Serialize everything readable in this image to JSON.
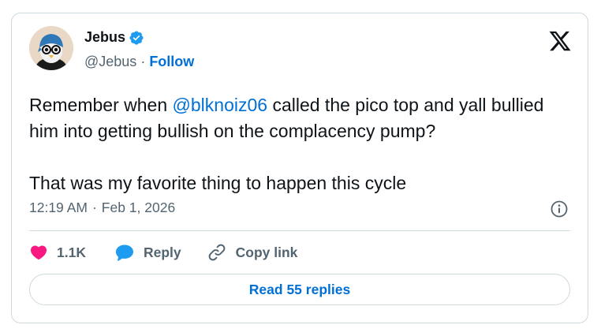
{
  "author": {
    "display_name": "Jebus",
    "handle": "@Jebus",
    "separator": "·",
    "follow_label": "Follow",
    "verified_color": "#1d9bf0",
    "avatar_icon": "penguin-avatar-icon"
  },
  "tweet": {
    "mention": "@blknoiz06",
    "line1_before": "Remember when ",
    "line1_after": " called the pico top and yall bullied him into getting bullish on the complacency pump?",
    "line2": "That was my favorite thing to happen this cycle"
  },
  "meta": {
    "time": "12:19 AM",
    "separator": "·",
    "date": "Feb 1, 2026",
    "info_icon": "info-icon"
  },
  "actions": {
    "like_count": "1.1K",
    "like_color": "#f91880",
    "reply_label": "Reply",
    "reply_color": "#1d9bf0",
    "copy_link_label": "Copy link"
  },
  "footer": {
    "read_replies_label": "Read 55 replies"
  },
  "colors": {
    "accent": "#006fd6",
    "text_primary": "#0f1419",
    "text_secondary": "#536471",
    "border": "#cfd9de"
  }
}
